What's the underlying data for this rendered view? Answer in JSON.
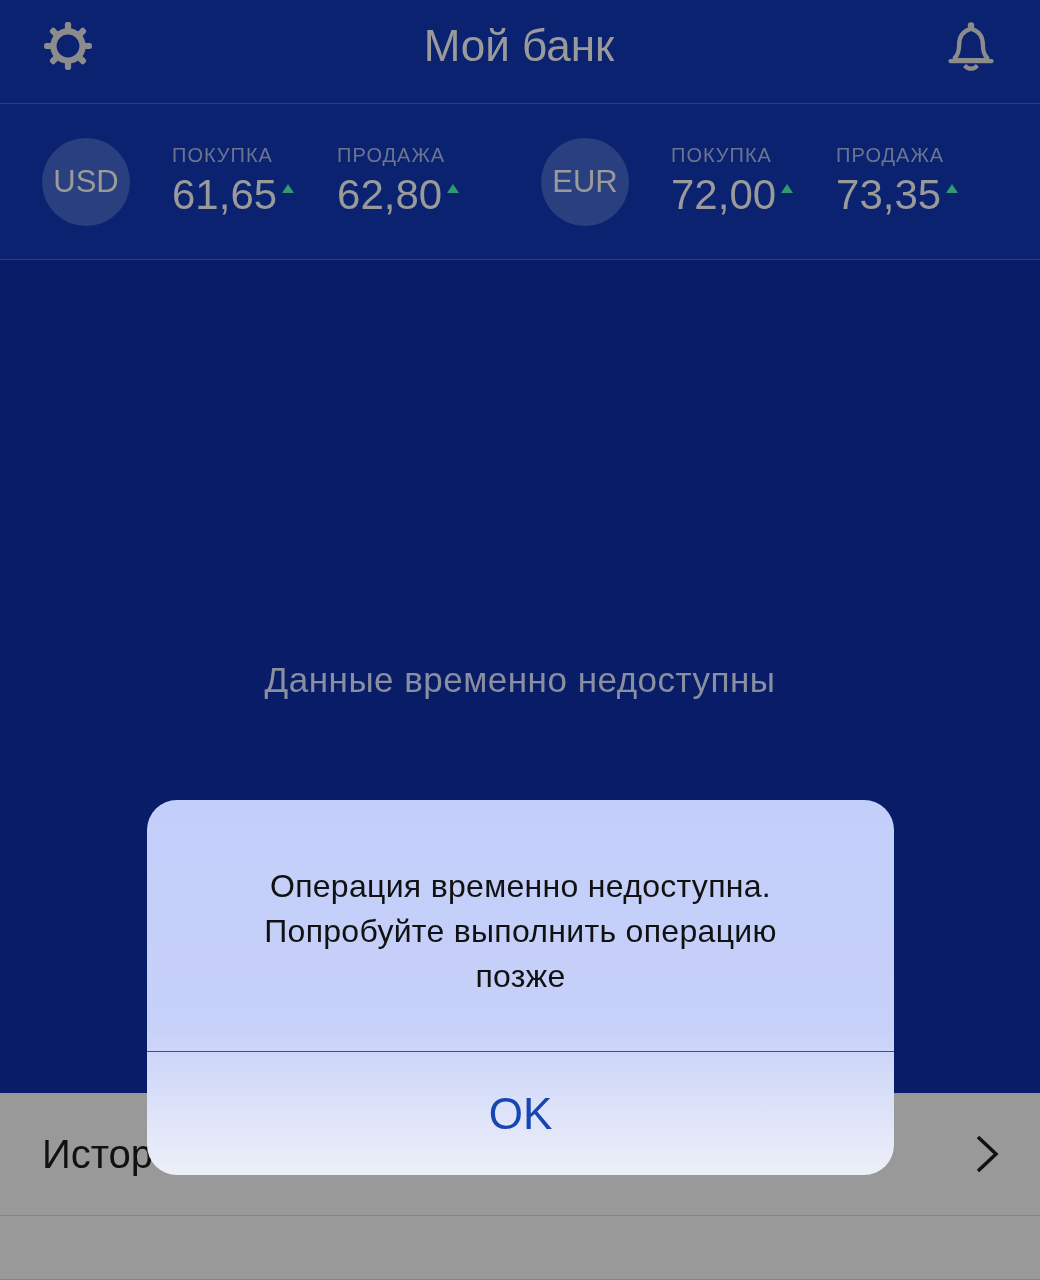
{
  "header": {
    "title": "Мой банк"
  },
  "rates": [
    {
      "currency": "USD",
      "quotes": [
        {
          "label": "ПОКУПКА",
          "value": "61,65",
          "rising": true
        },
        {
          "label": "ПРОДАЖА",
          "value": "62,80",
          "rising": true
        }
      ]
    },
    {
      "currency": "EUR",
      "quotes": [
        {
          "label": "ПОКУПКА",
          "value": "72,00",
          "rising": true
        },
        {
          "label": "ПРОДАЖА",
          "value": "73,35",
          "rising": true
        }
      ]
    }
  ],
  "empty_message": "Данные временно недоступны",
  "menu": [
    {
      "label": "Истор"
    }
  ],
  "alert": {
    "message": "Операция временно недоступна. Попробуйте выполнить операцию позже",
    "buttons": [
      "OK"
    ]
  }
}
